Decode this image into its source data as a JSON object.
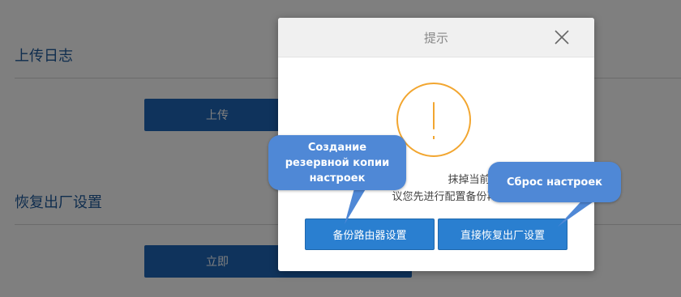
{
  "background": {
    "upload_section": {
      "title": "上传日志",
      "button_label": "上传"
    },
    "reset_section": {
      "title": "恢复出厂设置",
      "button_label": "立即"
    }
  },
  "dialog": {
    "title": "提示",
    "message_line1": "抹掉当前路由器",
    "message_line2": "议您先进行配置备份再恢复出",
    "backup_button_label": "备份路由器设置",
    "reset_button_label": "直接恢复出厂设置",
    "icon": "warning-icon",
    "close_icon": "close-icon"
  },
  "annotations": {
    "backup_note": [
      "Создание",
      "резервной копии",
      "настроек"
    ],
    "reset_note": "Сброс настроек"
  },
  "colors": {
    "primary_button": "#1f67b8",
    "dialog_button": "#2a7fd0",
    "warning": "#f2a630",
    "callout": "#4f88d6",
    "section_title": "#1e5a9c"
  }
}
